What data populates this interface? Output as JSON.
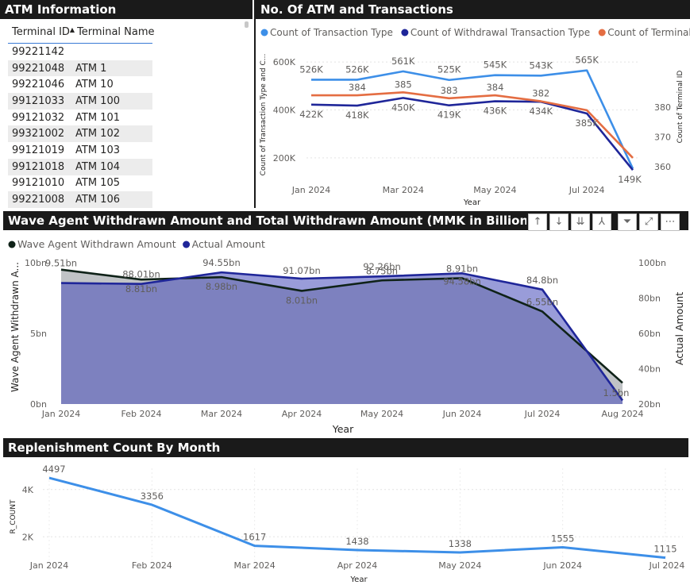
{
  "atm_info": {
    "title": "ATM Information",
    "columns": [
      "Terminal ID",
      "Terminal Name"
    ],
    "rows": [
      [
        "99221142",
        ""
      ],
      [
        "99221048",
        "ATM 1"
      ],
      [
        "99221046",
        "ATM 10"
      ],
      [
        "99121033",
        "ATM 100"
      ],
      [
        "99121032",
        "ATM 101"
      ],
      [
        "99321002",
        "ATM 102"
      ],
      [
        "99121019",
        "ATM 103"
      ],
      [
        "99121018",
        "ATM 104"
      ],
      [
        "99121010",
        "ATM 105"
      ],
      [
        "99221008",
        "ATM 106"
      ]
    ]
  },
  "visual_tools": [
    "↑",
    "↓",
    "⇊",
    "⅄",
    "⏷",
    "⤢",
    "⋯"
  ],
  "chart_data": [
    {
      "type": "line",
      "title": "No. Of ATM and Transactions",
      "xlabel": "Year",
      "ylabel": "Count of Transaction Type and C...",
      "y2label": "Count of Terminal ID",
      "x": [
        "Jan 2024",
        "Feb 2024",
        "Mar 2024",
        "Apr 2024",
        "May 2024",
        "Jun 2024",
        "Jul 2024",
        "Aug 2024"
      ],
      "xticks": [
        "Jan 2024",
        "Mar 2024",
        "May 2024",
        "Jul 2024"
      ],
      "ylim": [
        100000,
        660000
      ],
      "yticks": [
        "200K",
        "400K",
        "600K"
      ],
      "y2lim": [
        355,
        400
      ],
      "y2ticks": [
        "360",
        "370",
        "380"
      ],
      "legend": "top",
      "series": [
        {
          "name": "Count of Transaction Type",
          "color": "#3d8fe8",
          "axis": "left",
          "values": [
            526000,
            526000,
            561000,
            525000,
            545000,
            543000,
            565000,
            155000
          ],
          "labels": [
            "526K",
            "526K",
            "561K",
            "525K",
            "545K",
            "543K",
            "565K",
            ""
          ]
        },
        {
          "name": "Count of Withdrawal Transaction Type",
          "color": "#1f2699",
          "axis": "left",
          "values": [
            422000,
            418000,
            450000,
            419000,
            436000,
            434000,
            385000,
            149000
          ],
          "labels": [
            "422K",
            "418K",
            "450K",
            "419K",
            "436K",
            "434K",
            "385K",
            "149K"
          ]
        },
        {
          "name": "Count of Terminal ID",
          "color": "#e46d42",
          "axis": "right",
          "values": [
            384,
            384,
            385,
            383,
            384,
            382,
            379,
            363
          ],
          "labels": [
            "",
            "384",
            "385",
            "383",
            "384",
            "382",
            "",
            ""
          ]
        }
      ]
    },
    {
      "type": "area",
      "title": "Wave Agent Withdrawn Amount and Total Withdrawn Amount (MMK in Billions)",
      "xlabel": "Year",
      "ylabel": "Wave Agent Withdrawn A...",
      "y2label": "Actual Amount",
      "x": [
        "Jan 2024",
        "Feb 2024",
        "Mar 2024",
        "Apr 2024",
        "May 2024",
        "Jun 2024",
        "Jul 2024",
        "Aug 2024"
      ],
      "ylim": [
        0,
        10
      ],
      "yticks": [
        "0bn",
        "5bn",
        "10bn"
      ],
      "y2lim": [
        20,
        100
      ],
      "y2ticks": [
        "20bn",
        "40bn",
        "60bn",
        "80bn",
        "100bn"
      ],
      "legend": "top-left",
      "series": [
        {
          "name": "Wave Agent Withdrawn Amount",
          "color": "#0f2218",
          "axis": "left",
          "values": [
            9.51,
            8.81,
            8.98,
            8.01,
            8.75,
            8.91,
            6.55,
            1.5
          ],
          "labels": [
            "9.51bn",
            "8.81bn",
            "8.98bn",
            "8.01bn",
            "8.75bn",
            "8.91bn",
            "6.55bn",
            "1.5bn"
          ]
        },
        {
          "name": "Actual Amount",
          "color": "#1f2699",
          "axis": "right",
          "values": [
            88.5,
            88.01,
            94.55,
            91.0,
            92.26,
            94.0,
            84.8,
            22.0
          ],
          "labels": [
            "",
            "88.01bn",
            "94.55bn",
            "91.07bn",
            "92.26bn",
            "94.58bn",
            "84.8bn",
            ""
          ]
        }
      ]
    },
    {
      "type": "line",
      "title": "Replenishment Count By Month",
      "xlabel": "Year",
      "ylabel": "R_COUNT",
      "x": [
        "Jan 2024",
        "Feb 2024",
        "Mar 2024",
        "Apr 2024",
        "May 2024",
        "Jun 2024",
        "Jul 2024"
      ],
      "ylim": [
        1000,
        4700
      ],
      "yticks": [
        "2K",
        "4K"
      ],
      "series": [
        {
          "name": "R_COUNT",
          "color": "#3d8fe8",
          "values": [
            4497,
            3356,
            1617,
            1438,
            1338,
            1555,
            1115
          ],
          "labels": [
            "4497",
            "3356",
            "1617",
            "1438",
            "1338",
            "1555",
            "1115"
          ]
        }
      ]
    }
  ]
}
